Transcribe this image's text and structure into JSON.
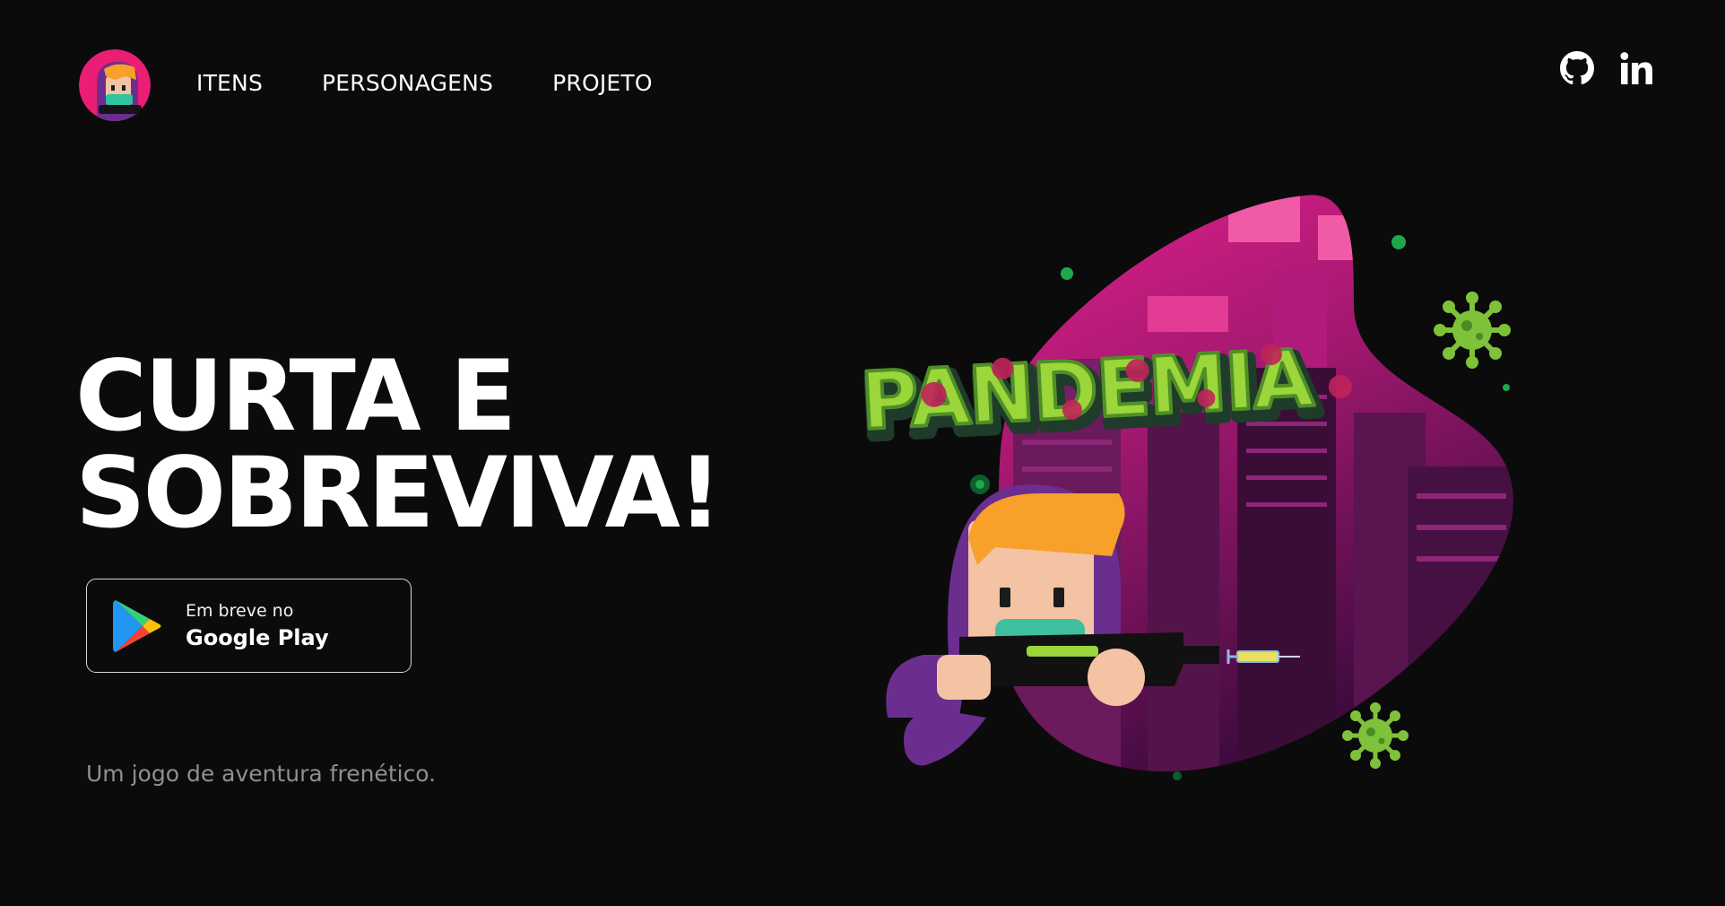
{
  "brand": {
    "logo_icon": "game-character-avatar-icon"
  },
  "nav": {
    "items": [
      {
        "label": "ITENS"
      },
      {
        "label": "PERSONAGENS"
      },
      {
        "label": "PROJETO"
      }
    ]
  },
  "social": {
    "github_icon": "github-icon",
    "linkedin_icon": "linkedin-icon"
  },
  "hero": {
    "headline_line1": "CURTA E",
    "headline_line2": "SOBREVIVA!",
    "store_button": {
      "small_text": "Em breve no",
      "big_text": "Google Play",
      "icon": "google-play-icon"
    },
    "tagline": "Um jogo de aventura frenético."
  },
  "artwork": {
    "game_logo_text": "PANDEMIA",
    "colors": {
      "blob_pink": "#d6197f",
      "blob_purple": "#5a0f52",
      "logo_green": "#9bd63a",
      "virus_green": "#7ec23a",
      "hood_purple": "#6b2e8f",
      "hair_orange": "#f7a02a"
    }
  }
}
